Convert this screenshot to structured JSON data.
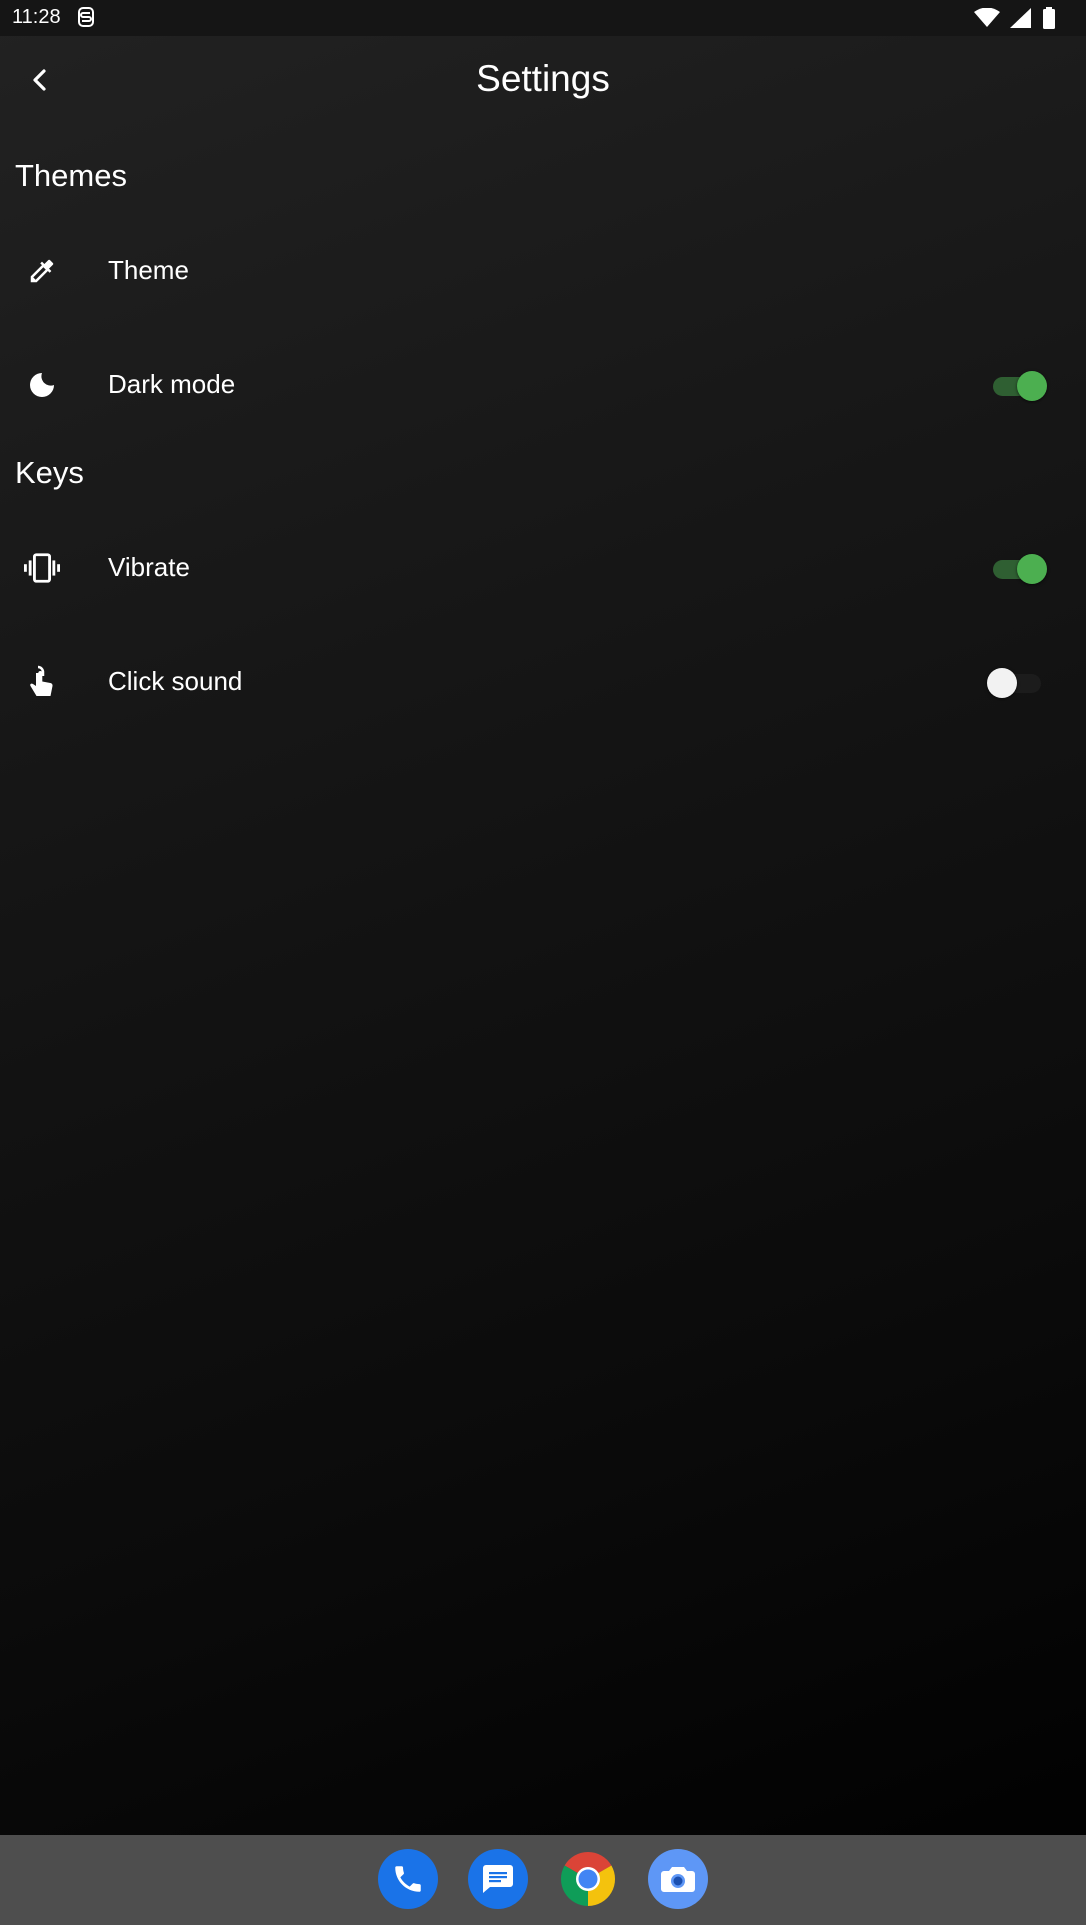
{
  "status_bar": {
    "time": "11:28",
    "left_icons": [
      "s-notification-icon"
    ],
    "right_icons": [
      "wifi-icon",
      "cell-signal-icon",
      "battery-icon"
    ]
  },
  "app_bar": {
    "title": "Settings",
    "back_icon": "chevron-left-icon"
  },
  "sections": [
    {
      "title": "Themes",
      "items": [
        {
          "label": "Theme",
          "icon": "eyedropper-icon"
        },
        {
          "label": "Dark mode",
          "icon": "moon-icon",
          "toggle": true
        }
      ]
    },
    {
      "title": "Keys",
      "items": [
        {
          "label": "Vibrate",
          "icon": "vibrate-icon",
          "toggle": true
        },
        {
          "label": "Click sound",
          "icon": "touch-icon",
          "toggle": false
        }
      ]
    }
  ],
  "dock": {
    "apps": [
      "phone-icon",
      "messages-icon",
      "chrome-icon",
      "camera-icon"
    ]
  },
  "colors": {
    "accent": "#4caf50",
    "accent_track": "#2f5f32",
    "dock_background": "#4e4e4e"
  }
}
